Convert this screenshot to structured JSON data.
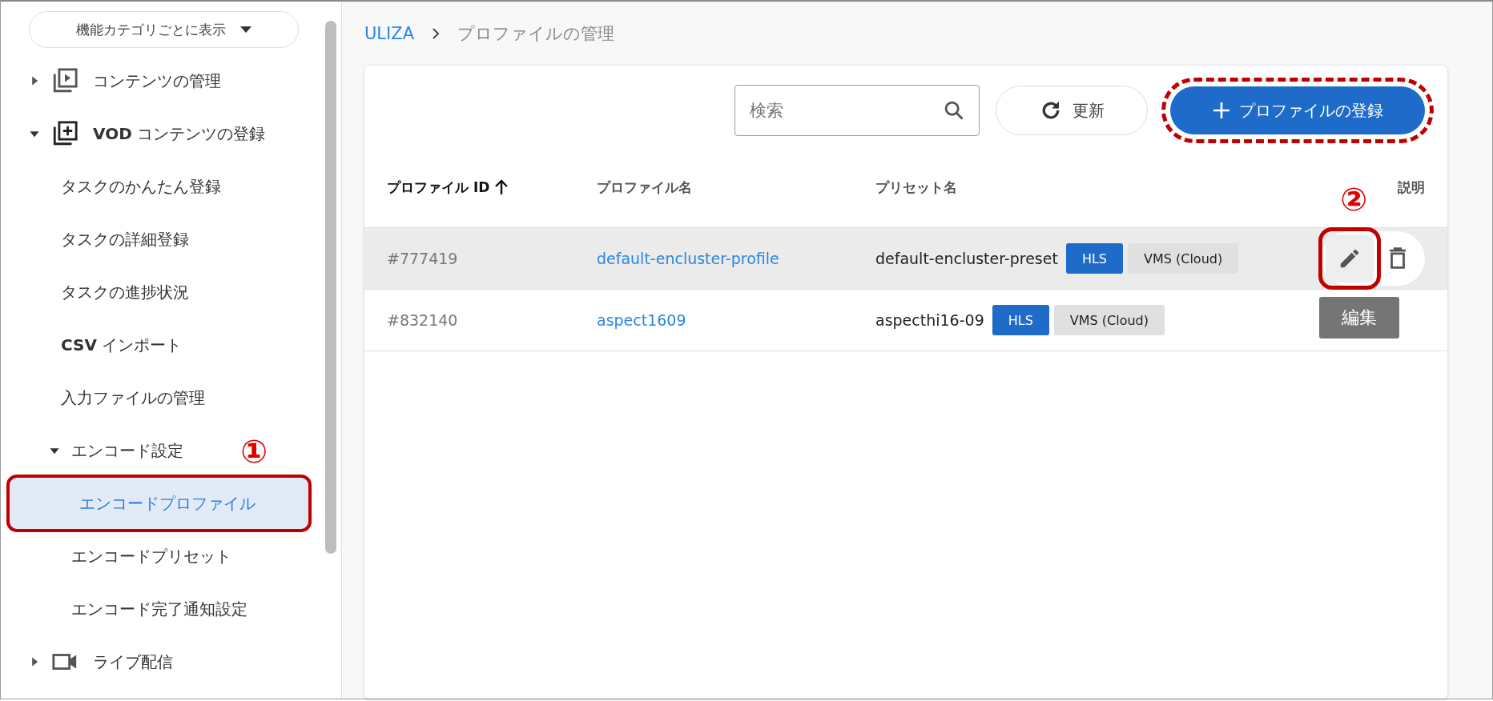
{
  "sidebar": {
    "view_select": "機能カテゴリごとに表示",
    "items": [
      {
        "label": "コンテンツの管理",
        "kind": "play",
        "expanded": false
      },
      {
        "label": "**VOD** コンテンツの登録",
        "kind": "add",
        "expanded": true,
        "children": [
          {
            "label": "タスクのかんたん登録",
            "selected": false
          },
          {
            "label": "タスクの詳細登録",
            "selected": false
          },
          {
            "label": "タスクの進捗状況",
            "selected": false
          },
          {
            "label": "**CSV** インポート",
            "selected": false
          },
          {
            "label": "入力ファイルの管理",
            "selected": false
          },
          {
            "label": "エンコード設定",
            "expanded": true,
            "children": [
              {
                "label": "エンコードプロファイル",
                "selected": true,
                "highlighted": true,
                "marker": "①"
              },
              {
                "label": "エンコードプリセット",
                "selected": false
              },
              {
                "label": "エンコード完了通知設定",
                "selected": false
              }
            ]
          }
        ]
      },
      {
        "label": "ライブ配信",
        "kind": "camera",
        "expanded": false
      }
    ]
  },
  "breadcrumb": [
    {
      "label": "ULIZA",
      "link": true
    },
    {
      "label": "プロファイルの管理",
      "link": false
    }
  ],
  "toolbar": {
    "search": {
      "placeholder": "検索"
    },
    "refresh": "更新",
    "add": {
      "label": "プロファイルの登録",
      "highlighted": true
    }
  },
  "table": {
    "columns": [
      {
        "label": "プロファイル ID",
        "sorted": true
      },
      {
        "label": "プロファイル名",
        "sorted": false
      },
      {
        "label": "プリセット名",
        "sorted": false
      },
      {
        "label": "説明",
        "sorted": false
      }
    ],
    "rows": [
      {
        "id": "#777419",
        "name": "default-encluster-profile",
        "preset": "default-encluster-preset",
        "tags": [
          {
            "label": "HLS",
            "kind": "primary"
          },
          {
            "label": "VMS (Cloud)",
            "kind": "neutral"
          }
        ],
        "hovered": true,
        "actions": {
          "highlighted": true,
          "marker": "②",
          "tooltip": "編集"
        }
      },
      {
        "id": "#832140",
        "name": "aspect1609",
        "preset": "aspecthi16-09",
        "tags": [
          {
            "label": "HLS",
            "kind": "primary"
          },
          {
            "label": "VMS (Cloud)",
            "kind": "neutral"
          }
        ],
        "hovered": false
      }
    ]
  }
}
